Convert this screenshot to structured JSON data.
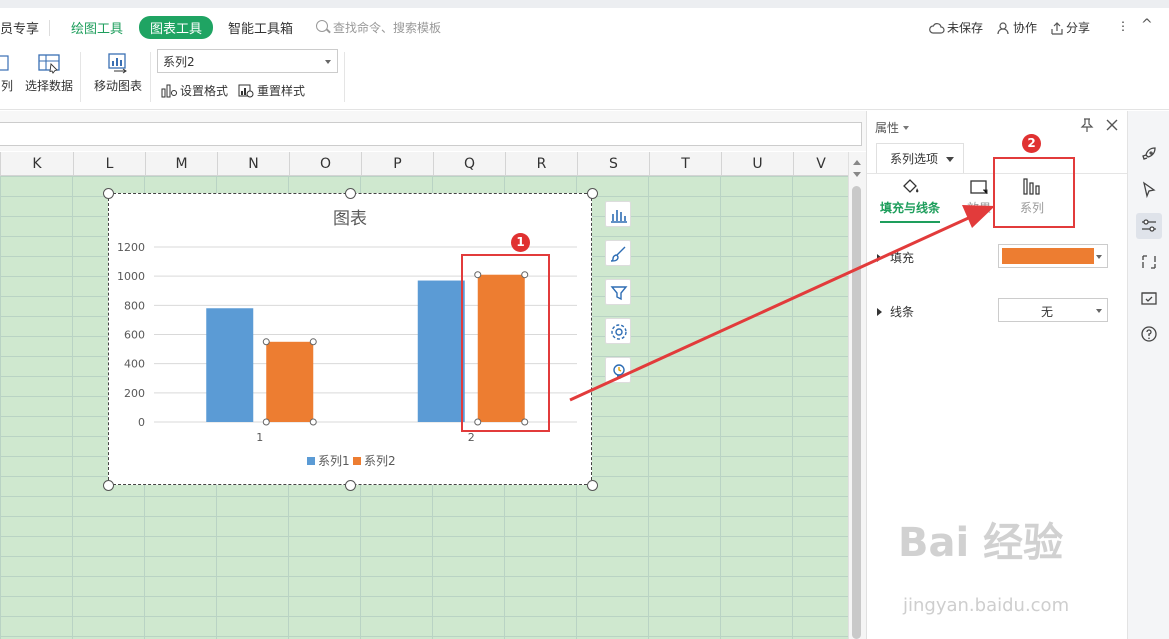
{
  "tabs": {
    "member": "员专享",
    "draw_tools": "绘图工具",
    "chart_tools": "图表工具",
    "smart_toolbox": "智能工具箱",
    "search_placeholder": "查找命令、搜索模板"
  },
  "topright": {
    "unsaved": "未保存",
    "collab": "协作",
    "share": "分享",
    "more": "⋮",
    "collapse": "^"
  },
  "ribbon": {
    "series_partial": "列",
    "select_data": "选择数据",
    "move_chart": "移动图表",
    "series_select_value": "系列2",
    "format": "设置格式",
    "reset_style": "重置样式"
  },
  "columns": [
    "K",
    "L",
    "M",
    "N",
    "O",
    "P",
    "Q",
    "R",
    "S",
    "T",
    "U",
    "V"
  ],
  "chart_data": {
    "type": "bar",
    "title": "图表",
    "categories": [
      "1",
      "2"
    ],
    "series": [
      {
        "name": "系列1",
        "values": [
          780,
          970
        ],
        "color": "#5b9bd5"
      },
      {
        "name": "系列2",
        "values": [
          550,
          1010
        ],
        "color": "#ed7d31"
      }
    ],
    "ylim": [
      0,
      1200
    ],
    "yticks": [
      "0",
      "200",
      "400",
      "600",
      "800",
      "1000",
      "1200"
    ],
    "grid": true,
    "legend": "bottom"
  },
  "annotations": {
    "badge1": "1",
    "badge2": "2"
  },
  "panel": {
    "title": "属性",
    "tab": "系列选项",
    "subtab_fill": "填充与线条",
    "subtab_effect": "效果",
    "subtab_series": "系列",
    "row_fill": "填充",
    "row_line": "线条",
    "line_value": "无",
    "fill_color": "#ed7d31"
  },
  "watermark": {
    "main": "Bai 经验",
    "sub": "jingyan.baidu.com"
  }
}
